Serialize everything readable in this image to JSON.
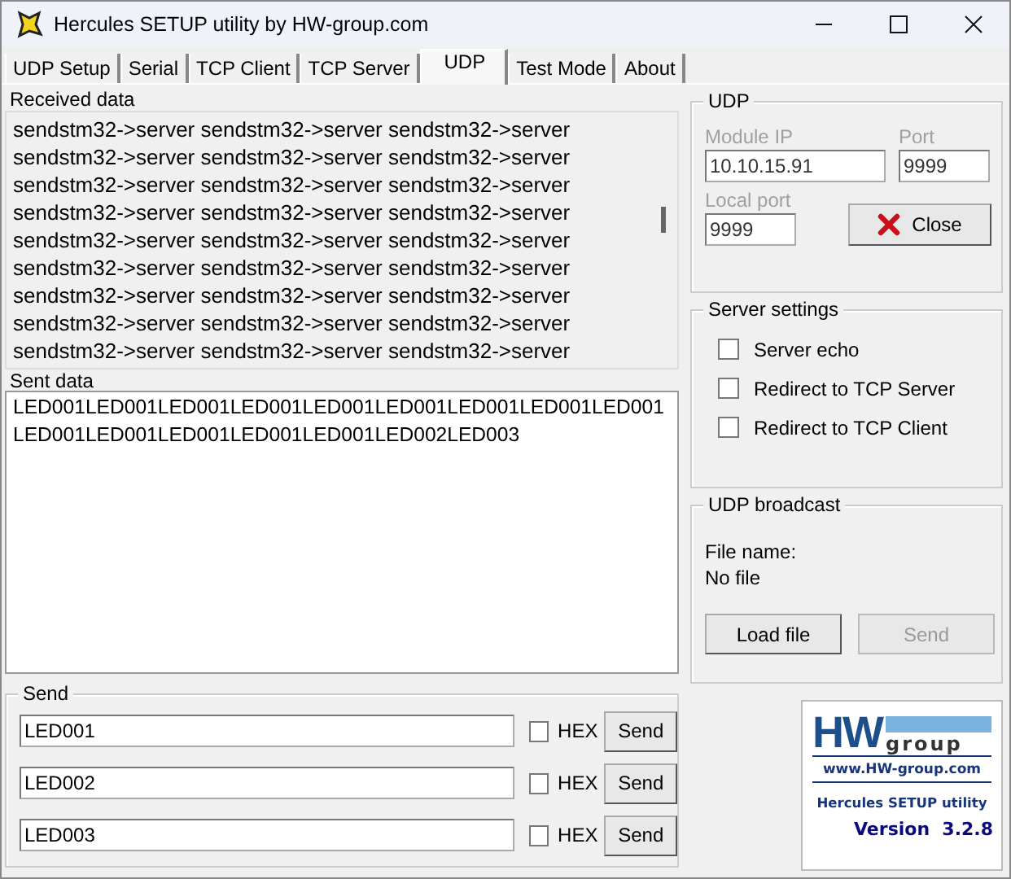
{
  "window": {
    "title": "Hercules SETUP utility by HW-group.com"
  },
  "tabs": [
    {
      "label": "UDP Setup",
      "selected": false
    },
    {
      "label": "Serial",
      "selected": false
    },
    {
      "label": "TCP Client",
      "selected": false
    },
    {
      "label": "TCP Server",
      "selected": false
    },
    {
      "label": "UDP",
      "selected": true
    },
    {
      "label": "Test Mode",
      "selected": false
    },
    {
      "label": "About",
      "selected": false
    }
  ],
  "received": {
    "label": "Received data",
    "lines": [
      "sendstm32->server sendstm32->server sendstm32->server",
      "sendstm32->server sendstm32->server sendstm32->server",
      "sendstm32->server sendstm32->server sendstm32->server",
      "sendstm32->server sendstm32->server sendstm32->server",
      "sendstm32->server sendstm32->server sendstm32->server",
      "sendstm32->server sendstm32->server sendstm32->server",
      "sendstm32->server sendstm32->server sendstm32->server",
      "sendstm32->server sendstm32->server sendstm32->server",
      "sendstm32->server sendstm32->server sendstm32->server"
    ]
  },
  "sent": {
    "label": "Sent data",
    "lines": [
      "LED001LED001LED001LED001LED001LED001LED001LED001LED001",
      "LED001LED001LED001LED001LED001LED002LED003"
    ]
  },
  "send": {
    "title": "Send",
    "rows": [
      {
        "value": "LED001",
        "hex_label": "HEX",
        "hex_checked": false,
        "button": "Send"
      },
      {
        "value": "LED002",
        "hex_label": "HEX",
        "hex_checked": false,
        "button": "Send"
      },
      {
        "value": "LED003",
        "hex_label": "HEX",
        "hex_checked": false,
        "button": "Send"
      }
    ]
  },
  "udp": {
    "title": "UDP",
    "module_ip": {
      "label": "Module IP",
      "value": "10.10.15.91",
      "disabled": true
    },
    "port": {
      "label": "Port",
      "value": "9999",
      "disabled": true
    },
    "local_port": {
      "label": "Local port",
      "value": "9999",
      "disabled": true
    },
    "close_button": "Close"
  },
  "server_settings": {
    "title": "Server settings",
    "options": [
      {
        "label": "Server echo",
        "checked": false
      },
      {
        "label": "Redirect to TCP Server",
        "checked": false
      },
      {
        "label": "Redirect to TCP Client",
        "checked": false
      }
    ]
  },
  "broadcast": {
    "title": "UDP broadcast",
    "file_label": "File name:",
    "file_value": "No file",
    "load_button": {
      "label": "Load file",
      "disabled": false
    },
    "send_button": {
      "label": "Send",
      "disabled": true
    }
  },
  "logo": {
    "brand_1": "HW",
    "brand_2": "group",
    "url": "www.HW-group.com",
    "product": "Hercules SETUP utility",
    "version": "Version  3.2.8"
  }
}
